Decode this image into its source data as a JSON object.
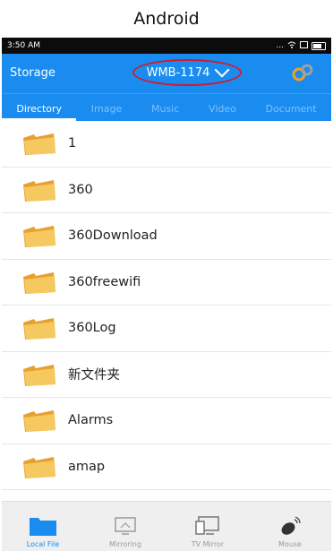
{
  "caption": "Android",
  "status_bar": {
    "time": "3:50 AM",
    "signal_text": "..."
  },
  "header": {
    "storage_label": "Storage",
    "device_name": "WMB-1174"
  },
  "tabs": [
    {
      "label": "Directory",
      "active": true
    },
    {
      "label": "Image",
      "active": false
    },
    {
      "label": "Music",
      "active": false
    },
    {
      "label": "Video",
      "active": false
    },
    {
      "label": "Document",
      "active": false
    }
  ],
  "files": [
    {
      "name": "1"
    },
    {
      "name": "360"
    },
    {
      "name": "360Download"
    },
    {
      "name": "360freewifi"
    },
    {
      "name": "360Log"
    },
    {
      "name": "新文件夹"
    },
    {
      "name": "Alarms"
    },
    {
      "name": "amap"
    }
  ],
  "bottom_nav": [
    {
      "label": "Local File",
      "icon": "folder-icon",
      "active": true
    },
    {
      "label": "Mirroring",
      "icon": "screen-mirror-icon",
      "active": false
    },
    {
      "label": "TV Mirror",
      "icon": "tv-mirror-icon",
      "active": false
    },
    {
      "label": "Mouse",
      "icon": "mouse-icon",
      "active": false
    }
  ],
  "colors": {
    "accent": "#1a8cf0",
    "highlight_circle": "#d21a2a",
    "folder": "#f2b640"
  }
}
